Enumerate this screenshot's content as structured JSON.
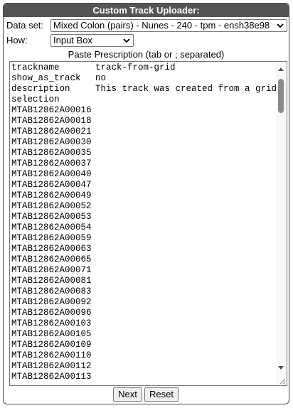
{
  "title": "Custom Track Uploader:",
  "dataset": {
    "label": "Data set:",
    "selected": "Mixed Colon (pairs) - Nunes - 240 - tpm - ensh38e98"
  },
  "how": {
    "label": "How:",
    "selected": "Input Box"
  },
  "paste_label": "Paste Prescription (tab or ; separated)",
  "textarea": {
    "header_rows": [
      {
        "key": "trackname",
        "value": "track-from-grid"
      },
      {
        "key": "show_as_track",
        "value": "no"
      },
      {
        "key": "description",
        "value": "This track was created from a grid"
      },
      {
        "key": "selection",
        "value": ""
      }
    ],
    "ids": [
      "MTAB12862A00016",
      "MTAB12862A00018",
      "MTAB12862A00021",
      "MTAB12862A00030",
      "MTAB12862A00035",
      "MTAB12862A00037",
      "MTAB12862A00040",
      "MTAB12862A00047",
      "MTAB12862A00049",
      "MTAB12862A00052",
      "MTAB12862A00053",
      "MTAB12862A00054",
      "MTAB12862A00059",
      "MTAB12862A00063",
      "MTAB12862A00065",
      "MTAB12862A00071",
      "MTAB12862A00081",
      "MTAB12862A00083",
      "MTAB12862A00092",
      "MTAB12862A00096",
      "MTAB12862A00103",
      "MTAB12862A00105",
      "MTAB12862A00109",
      "MTAB12862A00110",
      "MTAB12862A00112",
      "MTAB12862A00113"
    ]
  },
  "buttons": {
    "next": "Next",
    "reset": "Reset"
  },
  "icons": {
    "dropdown": "chevron-down-icon",
    "scroll_up": "arrow-up-icon",
    "scroll_down": "arrow-down-icon",
    "resize": "resize-grip-icon"
  }
}
